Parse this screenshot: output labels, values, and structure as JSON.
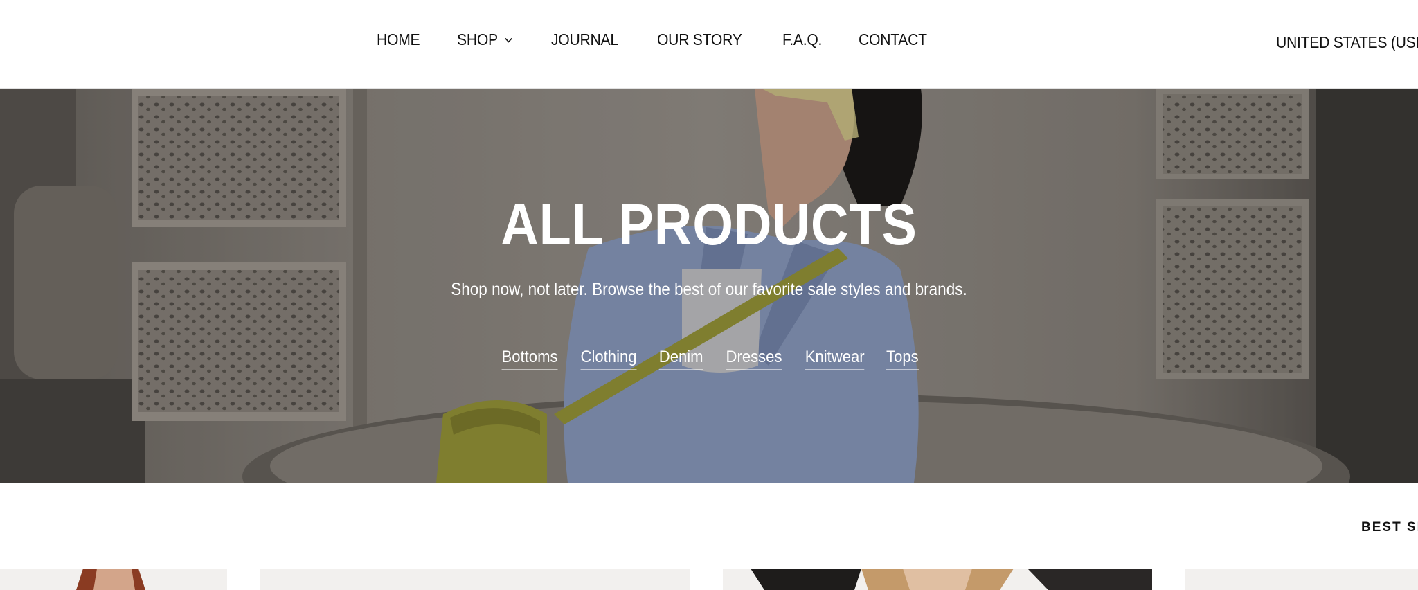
{
  "nav": {
    "items": [
      {
        "label": "HOME"
      },
      {
        "label": "SHOP",
        "has_dropdown": true
      },
      {
        "label": "JOURNAL"
      },
      {
        "label": "OUR STORY"
      },
      {
        "label": "F.A.Q."
      },
      {
        "label": "CONTACT"
      }
    ],
    "country_selector": "UNITED STATES (USD"
  },
  "hero": {
    "title": "ALL PRODUCTS",
    "subtitle": "Shop now, not later. Browse the best of our favorite sale styles and brands.",
    "categories": [
      "Bottoms",
      "Clothing",
      "Denim",
      "Dresses",
      "Knitwear",
      "Tops"
    ]
  },
  "collection": {
    "sort_label": "BEST SE"
  },
  "colors": {
    "text": "#111111",
    "card_bg": "#f2f0ee",
    "hero_overlay": "#8e8781",
    "blazer": "#8e9fc4",
    "bag": "#9c9a3a"
  }
}
